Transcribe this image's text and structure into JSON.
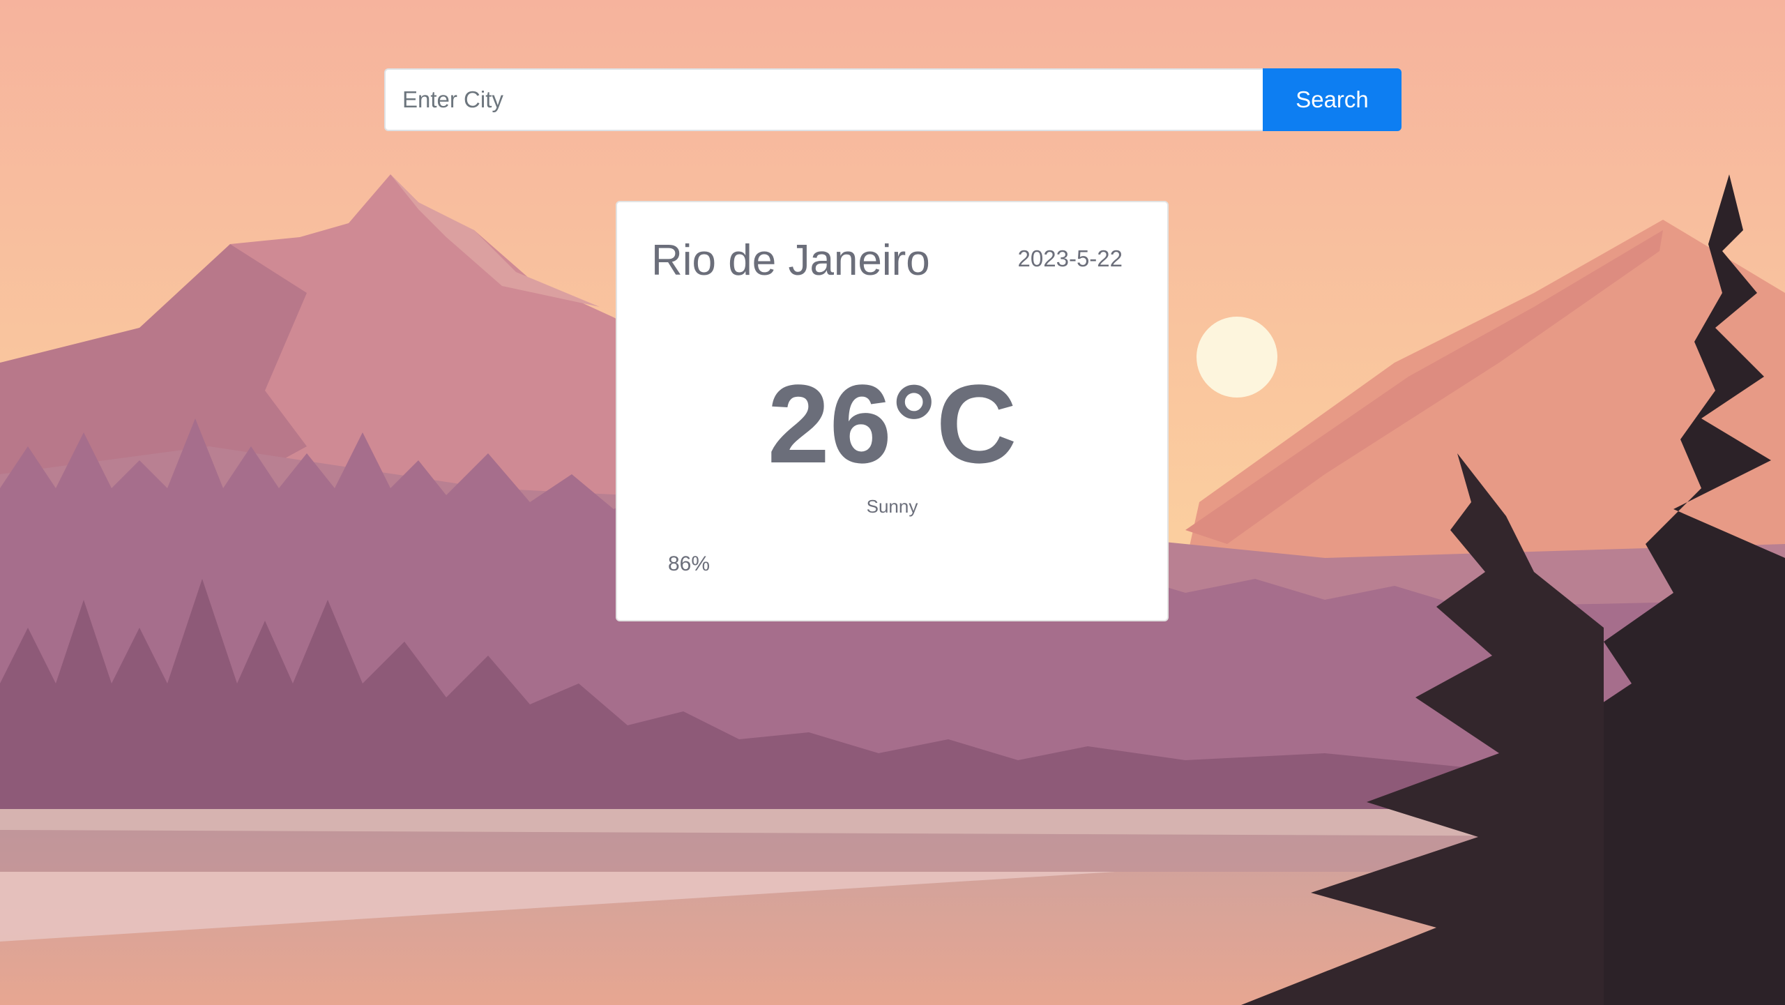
{
  "search": {
    "placeholder": "Enter City",
    "value": "",
    "button_label": "Search"
  },
  "weather": {
    "city": "Rio de Janeiro",
    "date": "2023-5-22",
    "temperature": "26°C",
    "condition": "Sunny",
    "humidity": "86%"
  },
  "colors": {
    "accent": "#0d7ef2",
    "card_text": "#6b6e7a",
    "sky_top": "#f6b39d",
    "sky_bottom": "#fbd9a4"
  }
}
